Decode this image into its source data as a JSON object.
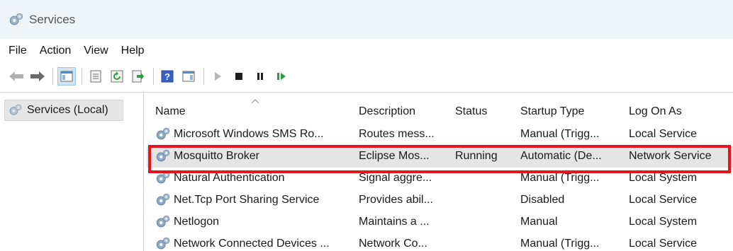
{
  "window": {
    "title": "Services",
    "icon": "services-gear-icon"
  },
  "menu": {
    "items": [
      "File",
      "Action",
      "View",
      "Help"
    ]
  },
  "toolbar": {
    "buttons": [
      "back-arrow-icon",
      "forward-arrow-icon",
      "show-hide-console-tree-icon",
      "properties-icon",
      "refresh-icon",
      "export-list-icon",
      "help-icon",
      "show-hide-action-pane-icon",
      "start-service-icon",
      "stop-service-icon",
      "pause-service-icon",
      "resume-service-icon"
    ]
  },
  "tree": {
    "root_label": "Services (Local)"
  },
  "columns": {
    "name": "Name",
    "description": "Description",
    "status": "Status",
    "startup_type": "Startup Type",
    "log_on_as": "Log On As"
  },
  "rows": [
    {
      "name": "Microsoft Windows SMS Ro...",
      "description": "Routes mess...",
      "status": "",
      "startup_type": "Manual (Trigg...",
      "log_on_as": "Local Service",
      "selected": false
    },
    {
      "name": "Mosquitto Broker",
      "description": "Eclipse Mos...",
      "status": "Running",
      "startup_type": "Automatic (De...",
      "log_on_as": "Network Service",
      "selected": true
    },
    {
      "name": "Natural Authentication",
      "description": "Signal aggre...",
      "status": "",
      "startup_type": "Manual (Trigg...",
      "log_on_as": "Local System",
      "selected": false
    },
    {
      "name": "Net.Tcp Port Sharing Service",
      "description": "Provides abil...",
      "status": "",
      "startup_type": "Disabled",
      "log_on_as": "Local Service",
      "selected": false
    },
    {
      "name": "Netlogon",
      "description": "Maintains a ...",
      "status": "",
      "startup_type": "Manual",
      "log_on_as": "Local System",
      "selected": false
    },
    {
      "name": "Network Connected Devices ...",
      "description": "Network Co...",
      "status": "",
      "startup_type": "Manual (Trigg...",
      "log_on_as": "Local Service",
      "selected": false
    }
  ],
  "colors": {
    "highlight": "#e8131b",
    "selected_row": "#e5e5e5",
    "titlebar": "#eef4f8"
  }
}
